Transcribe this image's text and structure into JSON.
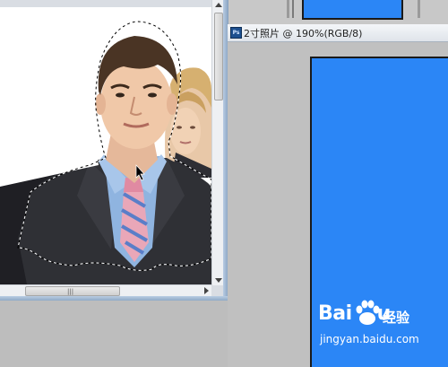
{
  "right_window": {
    "title": "2寸照片 @ 190%(RGB/8)",
    "app_icon": "photoshop-icon",
    "canvas_color": "#2b86f6"
  },
  "left_window": {
    "image": "portrait-with-selection",
    "selection": "marching-ants"
  },
  "watermark": {
    "logo_text": "Bai",
    "logo_text_tail": "u",
    "cn_text": "经验",
    "url": "jingyan.baidu.com"
  },
  "colors": {
    "workspace": "#c0c0c0",
    "canvas_blue": "#2b86f6",
    "frame_blue": "#8fa9c6"
  }
}
